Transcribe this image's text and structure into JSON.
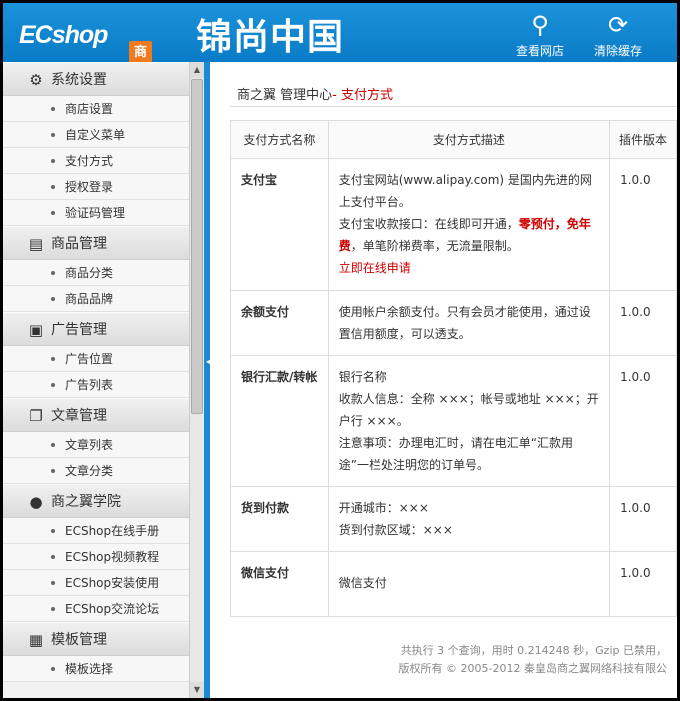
{
  "header": {
    "logo_text": "ECshop",
    "logo_badge": "商之翼版",
    "brand": "锦尚中国",
    "buttons": [
      {
        "label": "查看网店",
        "icon": "search-icon"
      },
      {
        "label": "清除缓存",
        "icon": "refresh-icon"
      }
    ]
  },
  "sidebar": {
    "groups": [
      {
        "label": "系统设置",
        "icon": "gear-icon",
        "items": [
          "商店设置",
          "自定义菜单",
          "支付方式",
          "授权登录",
          "验证码管理"
        ]
      },
      {
        "label": "商品管理",
        "icon": "document-icon",
        "items": [
          "商品分类",
          "商品品牌"
        ]
      },
      {
        "label": "广告管理",
        "icon": "image-icon",
        "items": [
          "广告位置",
          "广告列表"
        ]
      },
      {
        "label": "文章管理",
        "icon": "copy-icon",
        "items": [
          "文章列表",
          "文章分类"
        ]
      },
      {
        "label": "商之翼学院",
        "icon": "chat-icon",
        "items": [
          "ECShop在线手册",
          "ECShop视频教程",
          "ECShop安装使用",
          "ECShop交流论坛"
        ]
      },
      {
        "label": "模板管理",
        "icon": "template-icon",
        "items": [
          "模板选择"
        ]
      }
    ]
  },
  "breadcrumb": {
    "prefix": "商之翼 管理中心",
    "separator": "- ",
    "current": "支付方式"
  },
  "table": {
    "headers": [
      "支付方式名称",
      "支付方式描述",
      "插件版本"
    ],
    "rows": [
      {
        "name": "支付宝",
        "desc1": "支付宝网站(www.alipay.com) 是国内先进的网上支付平台。",
        "desc2_a": "支付宝收款接口：在线即可开通，",
        "desc2_red": "零预付，免年费",
        "desc2_b": "，单笔阶梯费率，无流量限制。",
        "link": "立即在线申请",
        "version": "1.0.0"
      },
      {
        "name": "余额支付",
        "desc": "使用帐户余额支付。只有会员才能使用，通过设置信用额度，可以透支。",
        "version": "1.0.0"
      },
      {
        "name": "银行汇款/转帐",
        "desc_lines": [
          "银行名称",
          "收款人信息：全称 ×××；帐号或地址 ×××；开户行 ×××。",
          "注意事项：办理电汇时，请在电汇单“汇款用途”一栏处注明您的订单号。"
        ],
        "version": "1.0.0"
      },
      {
        "name": "货到付款",
        "desc_lines": [
          "开通城市：×××",
          "货到付款区域：×××"
        ],
        "version": "1.0.0"
      },
      {
        "name": "微信支付",
        "desc": "微信支付",
        "version": "1.0.0"
      }
    ]
  },
  "footer": {
    "line1": "共执行 3 个查询，用时 0.214248 秒，Gzip 已禁用，",
    "line2": "版权所有 © 2005-2012 秦皇岛商之翼网络科技有限公"
  }
}
